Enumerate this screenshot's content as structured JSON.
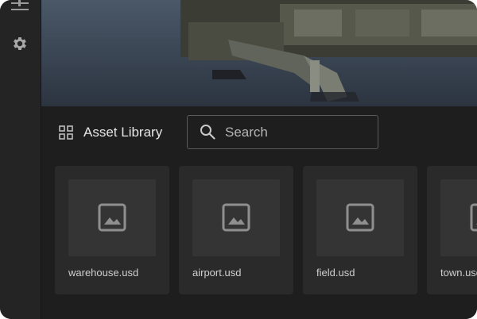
{
  "library": {
    "title": "Asset Library",
    "search_placeholder": "Search"
  },
  "assets": [
    {
      "name": "warehouse.usd"
    },
    {
      "name": "airport.usd"
    },
    {
      "name": "field.usd"
    },
    {
      "name": "town.usd"
    }
  ],
  "icons": {
    "sidebar": [
      "sliders-icon",
      "gear-icon"
    ],
    "library": "grid-icon",
    "search": "search-icon",
    "thumbnail": "image-icon"
  },
  "colors": {
    "background": "#1e1e1f",
    "card": "#2a2a2b",
    "thumbnail": "#343435",
    "text": "#e6e6e6"
  }
}
